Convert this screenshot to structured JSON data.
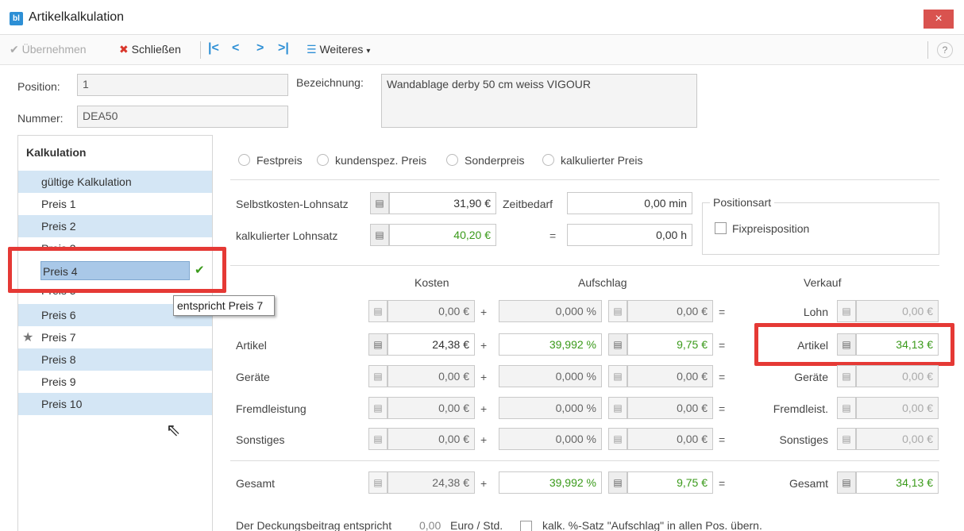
{
  "window": {
    "title": "Artikelkalkulation",
    "app_icon": "bl",
    "close": "×"
  },
  "toolbar": {
    "accept_label": "Übernehmen",
    "close_label": "Schließen",
    "nav_first": "|<",
    "nav_prev": "<",
    "nav_next": ">",
    "nav_last": ">|",
    "more_label": "Weiteres",
    "help": "?"
  },
  "header": {
    "position_label": "Position:",
    "position_value": "1",
    "number_label": "Nummer:",
    "number_value": "DEA50",
    "description_label": "Bezeichnung:",
    "description_value": "Wandablage derby 50 cm weiss VIGOUR"
  },
  "calc_list": {
    "title": "Kalkulation",
    "items": [
      "gültige Kalkulation",
      "Preis 1",
      "Preis 2",
      "Preis 3",
      "Preis 4",
      "Preis 5",
      "Preis 6",
      "Preis 7",
      "Preis 8",
      "Preis 9",
      "Preis 10"
    ],
    "tooltip": "entspricht Preis 7"
  },
  "price_types": [
    "Festpreis",
    "kundenspez. Preis",
    "Sonderpreis",
    "kalkulierter Preis"
  ],
  "labor": {
    "cost_rate_label": "Selbstkosten-Lohnsatz",
    "cost_rate_value": "31,90 €",
    "time_label": "Zeitbedarf",
    "time_value": "0,00 min",
    "calc_rate_label": "kalkulierter Lohnsatz",
    "calc_rate_value": "40,20 €",
    "equals": "=",
    "hours_value": "0,00 h",
    "position_type_label": "Positionsart",
    "fixed_price_label": "Fixpreisposition"
  },
  "table": {
    "col_costs": "Kosten",
    "col_markup": "Aufschlag",
    "col_sale": "Verkauf",
    "rows": [
      {
        "label": "",
        "cost": "0,00 €",
        "pct": "0,000 %",
        "markup": "0,00 €",
        "sale_label": "Lohn",
        "sale": "0,00 €"
      },
      {
        "label": "Artikel",
        "cost": "24,38 €",
        "pct": "39,992 %",
        "markup": "9,75 €",
        "sale_label": "Artikel",
        "sale": "34,13 €"
      },
      {
        "label": "Geräte",
        "cost": "0,00 €",
        "pct": "0,000 %",
        "markup": "0,00 €",
        "sale_label": "Geräte",
        "sale": "0,00 €"
      },
      {
        "label": "Fremdleistung",
        "cost": "0,00 €",
        "pct": "0,000 %",
        "markup": "0,00 €",
        "sale_label": "Fremdleist.",
        "sale": "0,00 €"
      },
      {
        "label": "Sonstiges",
        "cost": "0,00 €",
        "pct": "0,000 %",
        "markup": "0,00 €",
        "sale_label": "Sonstiges",
        "sale": "0,00 €"
      }
    ],
    "total": {
      "label": "Gesamt",
      "cost": "24,38 €",
      "pct": "39,992 %",
      "markup": "9,75 €",
      "sale_label": "Gesamt",
      "sale": "34,13 €"
    },
    "plus": "+",
    "eq": "="
  },
  "footer": {
    "contribution_text": "Der Deckungsbeitrag entspricht",
    "contribution_value": "0,00",
    "contribution_unit": "Euro / Std.",
    "apply_label": "kalk. %-Satz \"Aufschlag\" in allen Pos. übern."
  },
  "colors": {
    "accent": "#2d8fd5",
    "highlight_row": "#d4e6f5",
    "selected_row": "#a9c8e8",
    "annotation_red": "#e53935",
    "green_text": "#3a9a1a"
  }
}
